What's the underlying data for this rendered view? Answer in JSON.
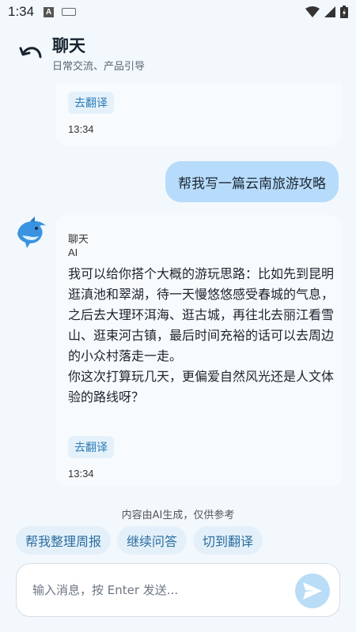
{
  "status_bar": {
    "time": "1:34",
    "app_icon_letter": "A"
  },
  "header": {
    "title": "聊天",
    "subtitle": "日常交流、产品引导"
  },
  "messages": {
    "previous": {
      "translate_label": "去翻译",
      "time": "13:34"
    },
    "user": {
      "text": "帮我写一篇云南旅游攻略"
    },
    "bot": {
      "name": "聊天",
      "model": "AI",
      "paragraphs": [
        "我可以给你搭个大概的游玩思路：比如先到昆明逛滇池和翠湖，待一天慢悠悠感受春城的气息，之后去大理环洱海、逛古城，再往北去丽江看雪山、逛束河古镇，最后时间充裕的话可以去周边的小众村落走一走。",
        "你这次打算玩几天，更偏爱自然风光还是人文体验的路线呀？"
      ],
      "translate_label": "去翻译",
      "time": "13:34"
    }
  },
  "disclaimer": "内容由AI生成，仅供参考",
  "suggestions": [
    "帮我整理周报",
    "继续问答",
    "切到翻译"
  ],
  "input": {
    "placeholder": "输入消息，按 Enter 发送...",
    "value": ""
  },
  "colors": {
    "accent": "#2c7cb5",
    "user_bubble": "#b7dcfb",
    "background": "#f3f8fd",
    "chip": "#e4f0f9"
  },
  "icons": {
    "back": "undo-arrow-icon",
    "send": "paper-plane-icon",
    "avatar": "dolphin-icon"
  }
}
